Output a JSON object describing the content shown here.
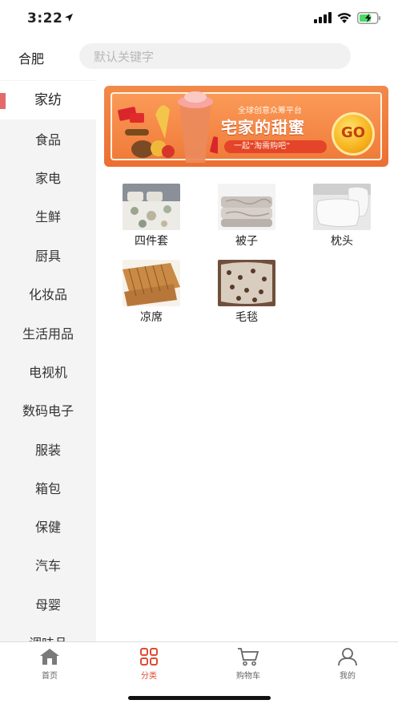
{
  "status_bar": {
    "time": "3:22"
  },
  "header": {
    "city": "合肥",
    "search_placeholder": "默认关键字"
  },
  "sidebar": {
    "items": [
      {
        "label": "家纺",
        "active": true
      },
      {
        "label": "食品"
      },
      {
        "label": "家电"
      },
      {
        "label": "生鲜"
      },
      {
        "label": "厨具"
      },
      {
        "label": "化妆品"
      },
      {
        "label": "生活用品"
      },
      {
        "label": "电视机"
      },
      {
        "label": "数码电子"
      },
      {
        "label": "服装"
      },
      {
        "label": "箱包"
      },
      {
        "label": "保健"
      },
      {
        "label": "汽车"
      },
      {
        "label": "母婴"
      },
      {
        "label": "调味品"
      }
    ]
  },
  "banner": {
    "subtitle": "全球创意众筹平台",
    "title": "宅家的甜蜜",
    "slogan": "一起“淘需购吧”",
    "go_label": "GO"
  },
  "products": [
    {
      "label": "四件套",
      "icon": "bedding-set"
    },
    {
      "label": "被子",
      "icon": "quilt"
    },
    {
      "label": "枕头",
      "icon": "pillow"
    },
    {
      "label": "凉席",
      "icon": "bamboo-mat"
    },
    {
      "label": "毛毯",
      "icon": "blanket"
    }
  ],
  "tabbar": {
    "items": [
      {
        "label": "首页",
        "icon": "home-icon"
      },
      {
        "label": "分类",
        "icon": "category-icon",
        "active": true
      },
      {
        "label": "购物车",
        "icon": "cart-icon"
      },
      {
        "label": "我的",
        "icon": "user-icon"
      }
    ]
  },
  "colors": {
    "accent": "#e04b35",
    "sidebar_bg": "#f4f4f4",
    "active_marker": "#e46a6a"
  }
}
